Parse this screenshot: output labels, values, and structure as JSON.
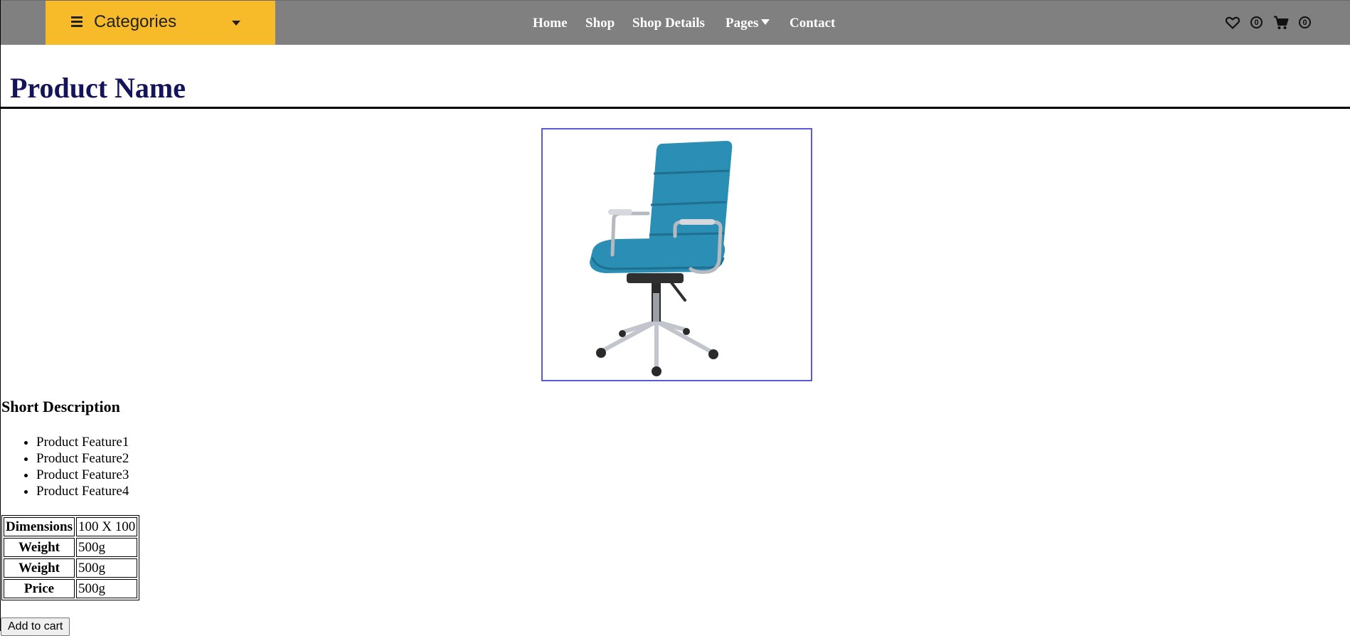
{
  "header": {
    "categories_label": "Categories",
    "nav": {
      "home": "Home",
      "shop": "Shop",
      "shop_details": "Shop Details",
      "pages": "Pages",
      "contact": "Contact"
    },
    "wishlist_count": "0",
    "cart_count": "0",
    "icons": [
      "menu-icon",
      "chevron-down-icon",
      "heart-icon",
      "cart-icon"
    ]
  },
  "product": {
    "name": "Product Name",
    "short_description_heading": "Short Description",
    "features": [
      "Product Feature1",
      "Product Feature2",
      "Product Feature3",
      "Product Feature4"
    ],
    "specs": [
      {
        "label": "Dimensions",
        "value": "100 X 100"
      },
      {
        "label": "Weight",
        "value": "500g"
      },
      {
        "label": "Weight",
        "value": "500g"
      },
      {
        "label": "Price",
        "value": "500g"
      }
    ],
    "add_to_cart_label": "Add to cart"
  },
  "colors": {
    "topbar": "#808080",
    "categories_bg": "#f7bb2a",
    "title": "#14145a",
    "image_border": "#5a5ad6",
    "chair": "#2b8fb5"
  }
}
